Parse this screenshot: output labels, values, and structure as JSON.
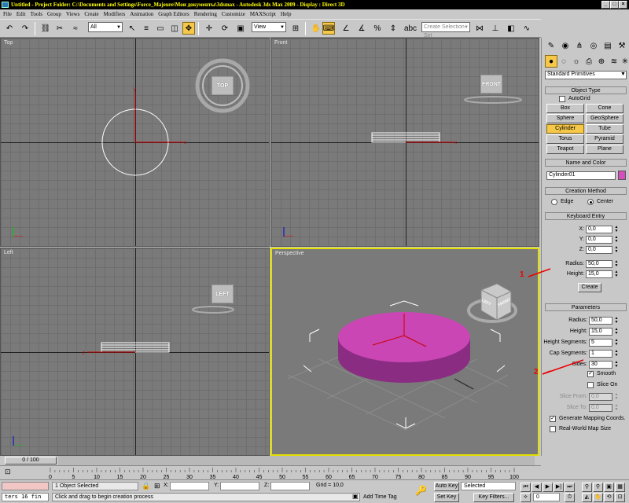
{
  "window": {
    "title": "Untitled    - Project Folder: C:\\Documents and Settings\\Force_Majeure\\Мои документы\\3dsmax      - Autodesk 3ds Max  2009      - Display : Direct 3D"
  },
  "menu": [
    "File",
    "Edit",
    "Tools",
    "Group",
    "Views",
    "Create",
    "Modifiers",
    "Animation",
    "Graph Editors",
    "Rendering",
    "Customize",
    "MAXScript",
    "Help"
  ],
  "toolbar": {
    "selection_filter": "All",
    "coord_system": "View",
    "selection_set_placeholder": "Create Selection Set"
  },
  "viewports": {
    "top": {
      "label": "Top",
      "cube": "TOP"
    },
    "front": {
      "label": "Front",
      "cube": "FRONT"
    },
    "left": {
      "label": "Left",
      "cube": "LEFT"
    },
    "perspective": {
      "label": "Perspective",
      "cube_faces": [
        "LEFT",
        "FRONT"
      ]
    }
  },
  "command_panel": {
    "category": "Standard Primitives",
    "object_type": {
      "title": "Object Type",
      "autogrid": "AutoGrid",
      "buttons": [
        "Box",
        "Cone",
        "Sphere",
        "GeoSphere",
        "Cylinder",
        "Tube",
        "Torus",
        "Pyramid",
        "Teapot",
        "Plane"
      ],
      "active": "Cylinder"
    },
    "name_color": {
      "title": "Name and Color",
      "name": "Cylinder01",
      "color": "#d64dbf"
    },
    "creation_method": {
      "title": "Creation Method",
      "edge": "Edge",
      "center": "Center"
    },
    "keyboard_entry": {
      "title": "Keyboard Entry",
      "x_label": "X:",
      "x": "0,0",
      "y_label": "Y:",
      "y": "0,0",
      "z_label": "Z:",
      "z": "0,0",
      "radius_label": "Radius:",
      "radius": "50,0",
      "height_label": "Height:",
      "height": "15,0",
      "create": "Create"
    },
    "parameters": {
      "title": "Parameters",
      "radius_label": "Radius:",
      "radius": "50,0",
      "height_label": "Height:",
      "height": "15,0",
      "height_segments_label": "Height Segments:",
      "height_segments": "5",
      "cap_segments_label": "Cap Segments:",
      "cap_segments": "1",
      "sides_label": "Sides:",
      "sides": "30",
      "smooth": "Smooth",
      "slice_on": "Slice On",
      "slice_from_label": "Slice From:",
      "slice_from": "0,0",
      "slice_to_label": "Slice To:",
      "slice_to": "0,0",
      "gen_mapping": "Generate Mapping Coords.",
      "real_world": "Real-World Map Size"
    }
  },
  "annotations": [
    "1",
    "2"
  ],
  "timeline": {
    "frame": "0 / 100",
    "ticks": [
      "0",
      "5",
      "10",
      "15",
      "20",
      "25",
      "30",
      "35",
      "40",
      "45",
      "50",
      "55",
      "60",
      "65",
      "70",
      "75",
      "80",
      "85",
      "90",
      "95",
      "100"
    ]
  },
  "status": {
    "script_field": "ters 16 fin",
    "selection": "1 Object Selected",
    "prompt": "Click and drag to begin creation process",
    "x_label": "X:",
    "y_label": "Y:",
    "z_label": "Z:",
    "grid": "Grid = 10,0",
    "add_time_tag": "Add Time Tag",
    "auto_key": "Auto Key",
    "set_key": "Set Key",
    "key_mode": "Selected",
    "key_filters": "Key Filters...",
    "current_frame": "0"
  }
}
